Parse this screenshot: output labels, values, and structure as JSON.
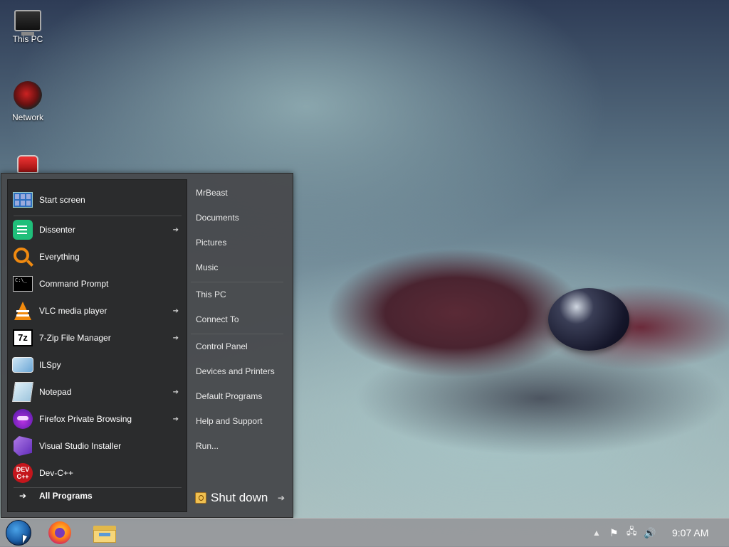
{
  "desktop": {
    "icons": [
      {
        "label": "This PC",
        "icon": "computer-icon"
      },
      {
        "label": "Network",
        "icon": "network-icon"
      },
      {
        "label": "",
        "icon": "red-device-icon"
      }
    ]
  },
  "start_menu": {
    "start_screen_label": "Start screen",
    "programs": [
      {
        "label": "Dissenter",
        "icon": "dissenter-icon",
        "has_submenu": true
      },
      {
        "label": "Everything",
        "icon": "everything-search-icon",
        "has_submenu": false
      },
      {
        "label": "Command Prompt",
        "icon": "command-prompt-icon",
        "has_submenu": false
      },
      {
        "label": "VLC media player",
        "icon": "vlc-icon",
        "has_submenu": true
      },
      {
        "label": "7-Zip File Manager",
        "icon": "7zip-icon",
        "has_submenu": true
      },
      {
        "label": "ILSpy",
        "icon": "ilspy-icon",
        "has_submenu": false
      },
      {
        "label": "Notepad",
        "icon": "notepad-icon",
        "has_submenu": true
      },
      {
        "label": "Firefox Private Browsing",
        "icon": "firefox-private-icon",
        "has_submenu": true
      },
      {
        "label": "Visual Studio Installer",
        "icon": "visual-studio-installer-icon",
        "has_submenu": false
      },
      {
        "label": "Dev-C++",
        "icon": "devcpp-icon",
        "has_submenu": false
      }
    ],
    "all_programs_label": "All Programs",
    "right_items": {
      "user": "MrBeast",
      "documents": "Documents",
      "pictures": "Pictures",
      "music": "Music",
      "this_pc": "This PC",
      "connect_to": "Connect To",
      "control_panel": "Control Panel",
      "devices_printers": "Devices and Printers",
      "default_programs": "Default Programs",
      "help_support": "Help and Support",
      "run": "Run..."
    },
    "shutdown_label": "Shut down",
    "icon_text": {
      "cmd": "C:\\_",
      "sevenzip": "7z",
      "devcpp": "DEV C++"
    }
  },
  "taskbar": {
    "clock": "9:07 AM",
    "tray_icons": [
      "chevron-up-icon",
      "flag-icon",
      "network-icon",
      "volume-icon"
    ],
    "pinned": [
      "firefox-icon",
      "file-explorer-icon"
    ]
  }
}
